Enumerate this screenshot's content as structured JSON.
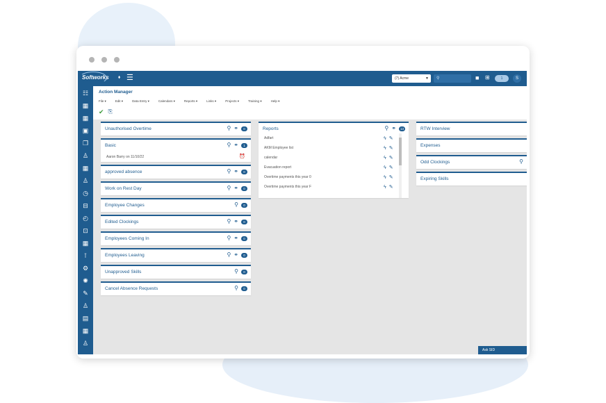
{
  "app": {
    "logo_text": "Softworks",
    "site_selector": "(7) Acme",
    "notification_count": "1",
    "user_initial": "S"
  },
  "header": {
    "title": "Action Manager",
    "menu": [
      "File",
      "Edit",
      "Data Entry",
      "Calendars",
      "Reports",
      "Links",
      "Projects",
      "Training",
      "Help"
    ]
  },
  "widgets_left": [
    {
      "title": "Unauthorised Overtime",
      "count": "0"
    },
    {
      "title": "Basic",
      "count": "1",
      "sub": "Aaron Barry on 11/10/22"
    },
    {
      "title": "approved absence",
      "count": "0"
    },
    {
      "title": "Work on Rest Day",
      "count": "0"
    },
    {
      "title": "Employee Changes",
      "count": "0"
    },
    {
      "title": "Edited Clockings",
      "count": "0"
    },
    {
      "title": "Employees Coming In",
      "count": "0"
    },
    {
      "title": "Employees Leaving",
      "count": "0"
    },
    {
      "title": "Unapproved Skills",
      "count": "0"
    },
    {
      "title": "Cancel Absence Requests",
      "count": "0"
    }
  ],
  "reports": {
    "title": "Reports",
    "count": "13",
    "items": [
      "Adfart",
      "AKM Employee list",
      "calendar",
      "Evacuation report",
      "Overtime payments this year 0",
      "Overtime payments this year F"
    ]
  },
  "widgets_right": [
    {
      "title": "RTW Interview"
    },
    {
      "title": "Expenses"
    },
    {
      "title": "Odd Clockings"
    },
    {
      "title": "Expiring Skills"
    }
  ],
  "ask_sid": "Ask SID"
}
